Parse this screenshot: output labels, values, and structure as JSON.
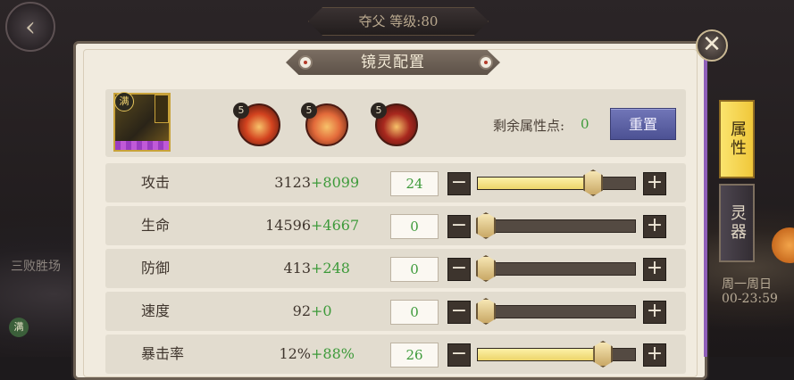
{
  "background": {
    "top_banner": "夺父 等级:80",
    "left_text": "三败胜场",
    "left_badge": "满",
    "right_text1": "周一周日",
    "right_text2": "00-23:59"
  },
  "dialog": {
    "title": "镜灵配置",
    "close_label": "✕"
  },
  "header": {
    "avatar_badge": "满",
    "skills": [
      {
        "level": "5",
        "color": "#d3431f"
      },
      {
        "level": "5",
        "color": "#e36a3a"
      },
      {
        "level": "5",
        "color": "#a8281e"
      }
    ],
    "remain_label": "剩余属性点:",
    "remain_value": "0",
    "reset_label": "重置"
  },
  "stats": [
    {
      "name": "攻击",
      "base": "3123",
      "bonus": "+8099",
      "points": "24",
      "level": 0.76
    },
    {
      "name": "生命",
      "base": "14596",
      "bonus": "+4667",
      "points": "0",
      "level": 0.0
    },
    {
      "name": "防御",
      "base": "413",
      "bonus": "+248",
      "points": "0",
      "level": 0.0
    },
    {
      "name": "速度",
      "base": "92",
      "bonus": "+0",
      "points": "0",
      "level": 0.0
    },
    {
      "name": "暴击率",
      "base": "12%",
      "bonus": "+88%",
      "points": "26",
      "level": 0.83
    }
  ],
  "tabs": [
    {
      "label": "属性",
      "active": true
    },
    {
      "label": "灵器",
      "active": false
    }
  ],
  "colors": {
    "bonus_green": "#3d9a3a",
    "slider_fill": "#ecd46a",
    "active_tab": "#f0c73a",
    "reset_button": "#5a5fa6"
  }
}
